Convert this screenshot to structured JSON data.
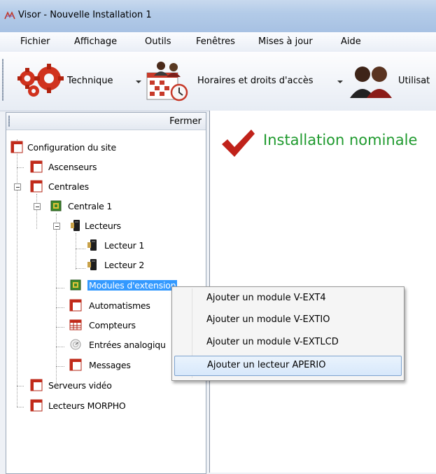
{
  "window": {
    "title": "Visor - Nouvelle Installation 1"
  },
  "menu": [
    "Fichier",
    "Affichage",
    "Outils",
    "Fenêtres",
    "Mises à jour",
    "Aide"
  ],
  "toolbar": {
    "technique": "Technique",
    "horaires": "Horaires et droits d'accès",
    "utilisateurs": "Utilisat"
  },
  "left_panel": {
    "close_label": "Fermer",
    "tree": {
      "root": "Configuration du site",
      "ascenseurs": "Ascenseurs",
      "centrales": "Centrales",
      "centrale1": "Centrale 1",
      "lecteurs": "Lecteurs",
      "lecteur1": "Lecteur 1",
      "lecteur2": "Lecteur 2",
      "modules": "Modules d'extension",
      "automatismes": "Automatismes",
      "compteurs": "Compteurs",
      "entrees": "Entrées analogiqu",
      "messages": "Messages",
      "serveurs": "Serveurs vidéo",
      "morpho": "Lecteurs MORPHO"
    }
  },
  "main": {
    "status": "Installation nominale"
  },
  "context_menu": [
    "Ajouter un module V-EXT4",
    "Ajouter un module V-EXTIO",
    "Ajouter un module V-EXTLCD",
    "Ajouter un lecteur APERIO"
  ]
}
